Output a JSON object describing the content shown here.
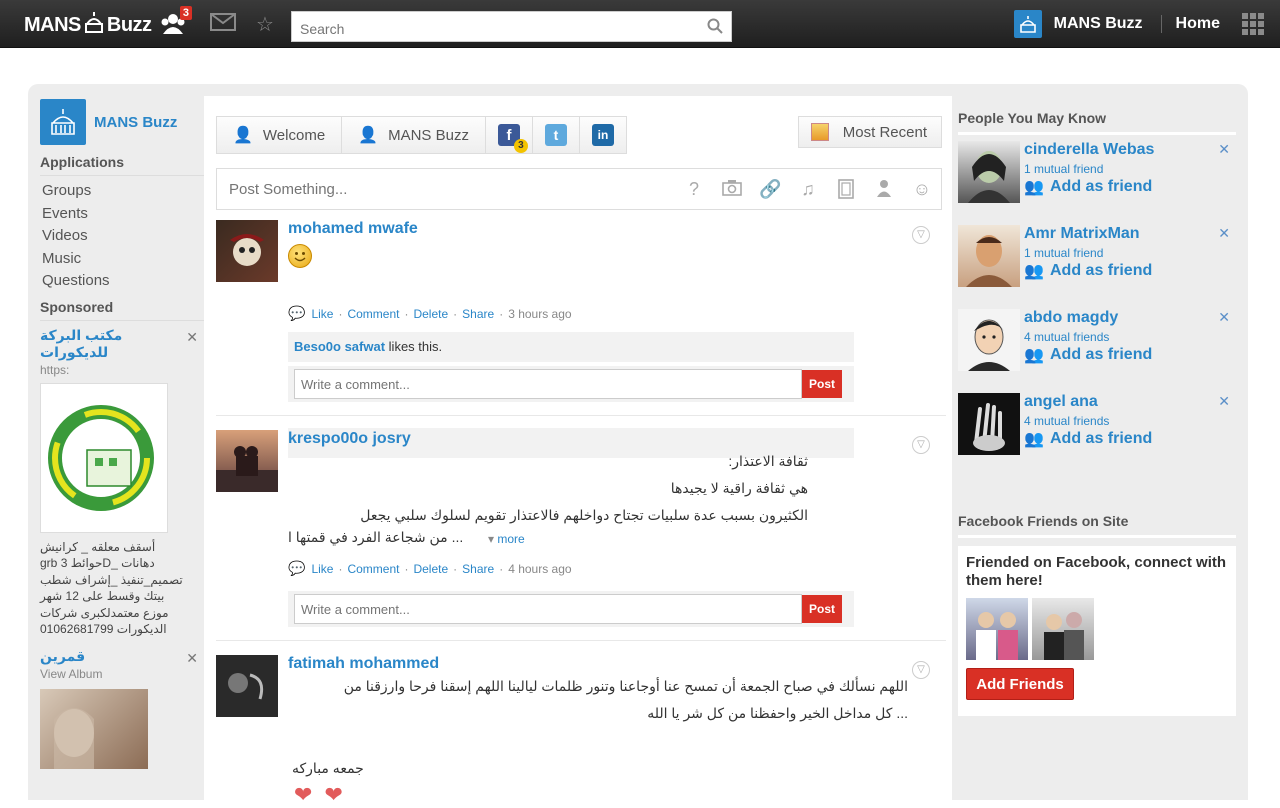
{
  "topbar": {
    "logo_left": "MANS",
    "logo_right": "Buzz",
    "friends_badge": "3",
    "search_placeholder": "Search",
    "user_name": "MANS Buzz",
    "home_label": "Home"
  },
  "sidebar": {
    "profile_name": "MANS Buzz",
    "applications_heading": "Applications",
    "apps": [
      "Groups",
      "Events",
      "Videos",
      "Music",
      "Questions"
    ],
    "sponsored_heading": "Sponsored",
    "ad1": {
      "title": "مكتب البركة للديكورات",
      "sub": "https:",
      "desc": "أسقف معلقه _ كرانيش دهانات _Dحوائط 3 grb تصميم_تنفيذ _إشراف شطب بيتك وقسط على 12 شهر موزع معتمدلكبرى شركات الديكورات 01062681799"
    },
    "ad2": {
      "title": "قمرين",
      "sub": "View Album"
    }
  },
  "tabs": {
    "welcome": "Welcome",
    "mans_buzz": "MANS Buzz",
    "fb_badge": "3",
    "most_recent": "Most Recent"
  },
  "composer": {
    "placeholder": "Post Something..."
  },
  "posts": [
    {
      "author": "mohamed mwafe",
      "like": "Like",
      "comment": "Comment",
      "delete": "Delete",
      "share": "Share",
      "time": "3 hours ago",
      "liker": "Beso0o safwat",
      "likes_text": "likes this.",
      "comment_placeholder": "Write a comment...",
      "post_btn": "Post"
    },
    {
      "author": "krespo00o josry",
      "line1": "ثقافة الاعتذار:",
      "line2": "هي ثقافة راقية لا يجيدها",
      "line3": "الكثيرون بسبب عدة سلبيات تجتاح دواخلهم فالاعتذار تقويم لسلوك سلبي يجعل",
      "line4": "... من شجاعة الفرد في قمتها ا",
      "more": "more",
      "like": "Like",
      "comment": "Comment",
      "delete": "Delete",
      "share": "Share",
      "time": "4 hours ago",
      "comment_placeholder": "Write a comment...",
      "post_btn": "Post"
    },
    {
      "author": "fatimah mohammed",
      "line1": "اللهم نسألك في صباح الجمعة أن تمسح عنا أوجاعنا وتنور ظلمات ليالينا اللهم إسقنا فرحا وارزقنا من",
      "line2": "... كل مداخل الخير واحفظنا من كل شر يا الله",
      "line3": "جمعه مباركه"
    }
  ],
  "right": {
    "pymk_heading": "People You May Know",
    "people": [
      {
        "name": "cinderella Webas",
        "mutual": "1 mutual friend",
        "add": "Add as friend"
      },
      {
        "name": "Amr MatrixMan",
        "mutual": "1 mutual friend",
        "add": "Add as friend"
      },
      {
        "name": "abdo magdy",
        "mutual": "4 mutual friends",
        "add": "Add as friend"
      },
      {
        "name": "angel ana",
        "mutual": "4 mutual friends",
        "add": "Add as friend"
      }
    ],
    "fbf_heading": "Facebook Friends on Site",
    "fbf_text": "Friended on Facebook, connect with them here!",
    "fbf_button": "Add Friends"
  },
  "colors": {
    "link": "#2a86c8",
    "danger": "#d93025",
    "topbar": "#2a2a2a"
  }
}
